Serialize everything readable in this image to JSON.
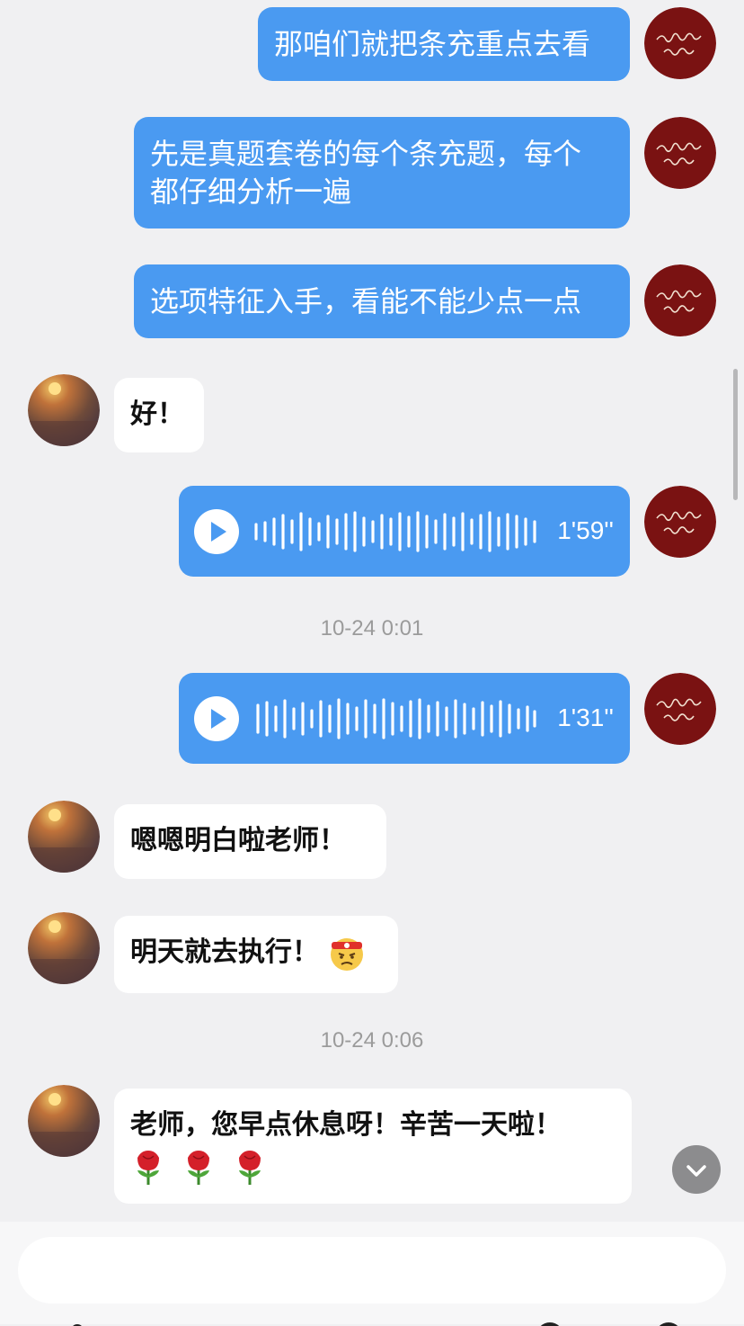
{
  "messages": [
    {
      "from": "teacher",
      "type": "text",
      "text": "那咱们就把条充重点去看"
    },
    {
      "from": "teacher",
      "type": "text",
      "line1": "先是真题套卷的每个条充题，每个",
      "line2": "都仔细分析一遍"
    },
    {
      "from": "teacher",
      "type": "text",
      "text": "选项特征入手，看能不能少点一点"
    },
    {
      "from": "student",
      "type": "text",
      "text": "好！"
    },
    {
      "from": "teacher",
      "type": "voice",
      "duration": "1'59''"
    },
    {
      "type": "timestamp",
      "text": "10-24 0:01"
    },
    {
      "from": "teacher",
      "type": "voice",
      "duration": "1'31''"
    },
    {
      "from": "student",
      "type": "text",
      "text": "嗯嗯明白啦老师！"
    },
    {
      "from": "student",
      "type": "text",
      "text": "明天就去执行！",
      "emoji": "determined-face-headband-emoji"
    },
    {
      "type": "timestamp",
      "text": "10-24 0:06"
    },
    {
      "from": "student",
      "type": "text",
      "text": "老师，您早点休息呀！辛苦一天啦！",
      "emoji": "rose-emoji"
    }
  ],
  "icons": {
    "teacher_avatar": "calligraphy-seal-avatar",
    "student_avatar": "sunset-photo-avatar",
    "voice_play": "play-icon",
    "scroll_down": "chevron-down-icon"
  },
  "colors": {
    "outgoing_bubble": "#4a9af1",
    "incoming_bubble": "#ffffff",
    "background": "#f0f0f2",
    "teacher_avatar_bg": "#7a1212"
  },
  "input": {
    "placeholder": "",
    "value": ""
  }
}
